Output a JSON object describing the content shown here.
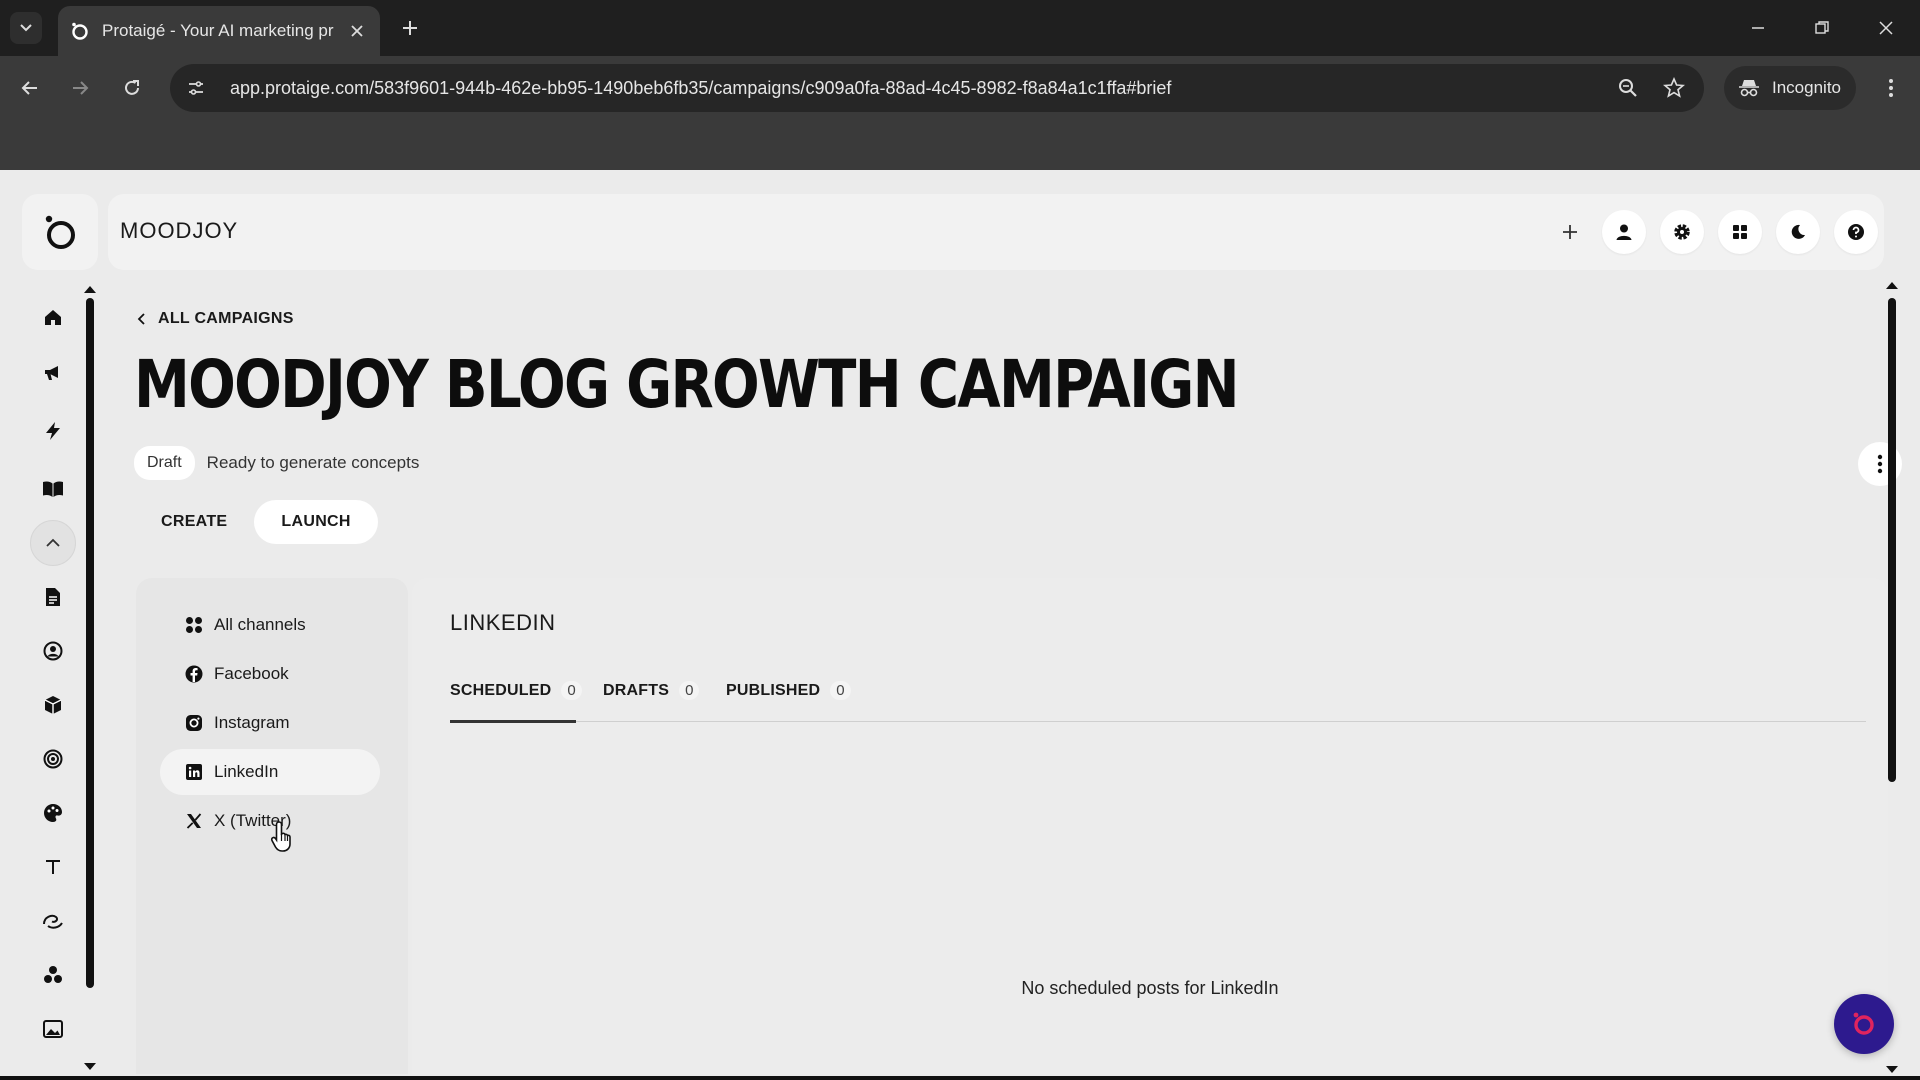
{
  "browser": {
    "tab_title": "Protaigé - Your AI marketing pr",
    "url": "app.protaige.com/583f9601-944b-462e-bb95-1490beb6fb35/campaigns/c909a0fa-88ad-4c45-8982-f8a84a1c1ffa#brief",
    "incognito_label": "Incognito"
  },
  "header": {
    "brand": "MOODJOY"
  },
  "sidebar": {
    "items": [
      {
        "name": "home-icon"
      },
      {
        "name": "campaigns-icon"
      },
      {
        "name": "bolt-icon"
      },
      {
        "name": "book-icon"
      },
      {
        "name": "collapse-icon"
      },
      {
        "name": "document-icon"
      },
      {
        "name": "persona-icon"
      },
      {
        "name": "product-icon"
      },
      {
        "name": "target-icon"
      },
      {
        "name": "palette-icon"
      },
      {
        "name": "text-icon"
      },
      {
        "name": "voice-icon"
      },
      {
        "name": "audience-icon"
      },
      {
        "name": "image-icon"
      }
    ]
  },
  "main": {
    "back_label": "ALL CAMPAIGNS",
    "title": "MOODJOY BLOG GROWTH CAMPAIGN",
    "status_badge": "Draft",
    "status_text": "Ready to generate concepts",
    "mode_tabs": [
      {
        "label": "CREATE",
        "active": false
      },
      {
        "label": "LAUNCH",
        "active": true
      }
    ],
    "channels": [
      {
        "label": "All channels",
        "icon": "grid-icon",
        "active": false
      },
      {
        "label": "Facebook",
        "icon": "facebook-icon",
        "active": false
      },
      {
        "label": "Instagram",
        "icon": "instagram-icon",
        "active": false
      },
      {
        "label": "LinkedIn",
        "icon": "linkedin-icon",
        "active": true
      },
      {
        "label": "X (Twitter)",
        "icon": "x-twitter-icon",
        "active": false
      }
    ],
    "content": {
      "title": "LINKEDIN",
      "subtabs": [
        {
          "label": "SCHEDULED",
          "count": "0",
          "active": true
        },
        {
          "label": "DRAFTS",
          "count": "0",
          "active": false
        },
        {
          "label": "PUBLISHED",
          "count": "0",
          "active": false
        }
      ],
      "empty_message": "No scheduled posts for LinkedIn"
    }
  },
  "colors": {
    "chat_fab": "#2d1a8e",
    "chat_fab_accent": "#e0245e",
    "chrome_dark": "#1f1f1f",
    "page_bg": "#ebebeb"
  }
}
